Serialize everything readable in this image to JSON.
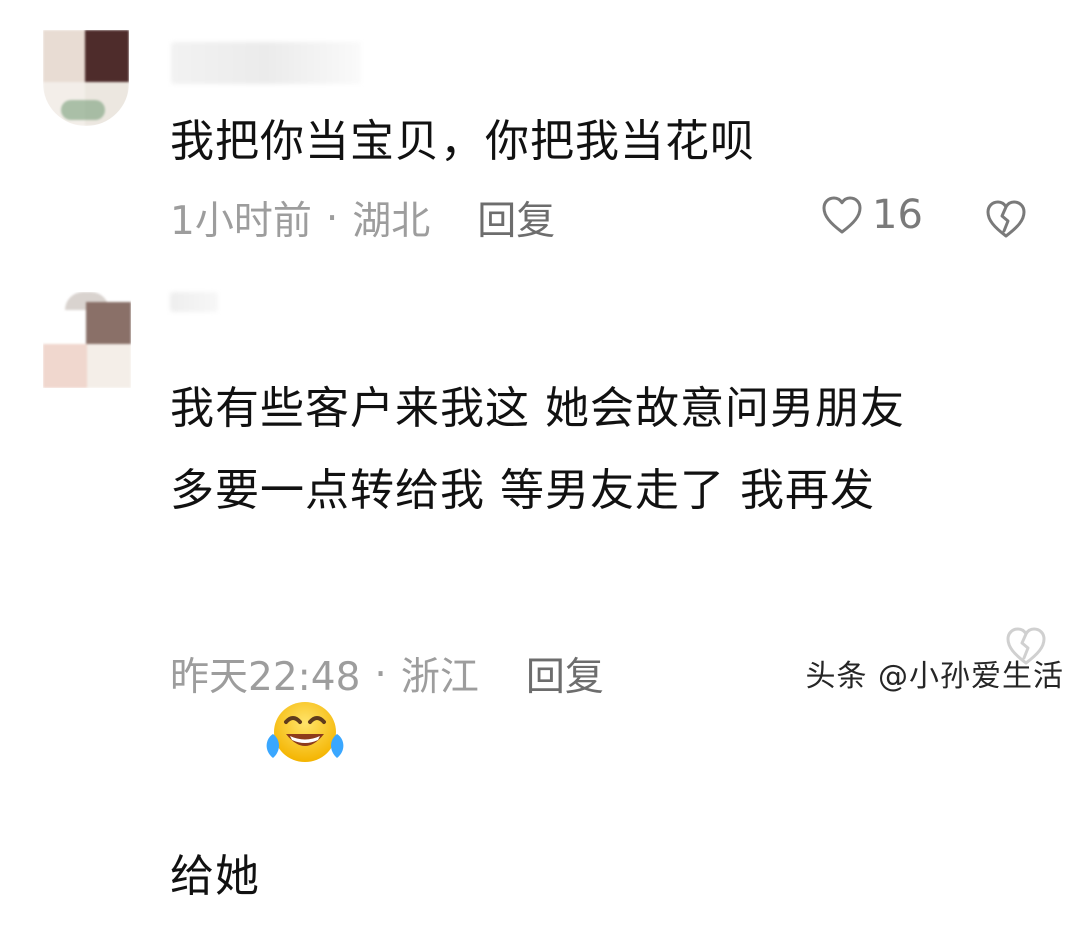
{
  "comments": [
    {
      "text": "我把你当宝贝，你把我当花呗",
      "time": "1小时前",
      "location": "湖北",
      "reply": "回复",
      "likes": "16"
    },
    {
      "text": "我有些客户来我这 她会故意问男朋友\n多要一点转给我 等男友走了 我再发\n给她",
      "time": "昨天22:48",
      "location": "浙江",
      "reply": "回复"
    }
  ],
  "ui": {
    "dot": "·",
    "watermark": "头条 @小孙爱生活",
    "icons": {
      "like": "heart-outline-icon",
      "dislike": "broken-heart-icon",
      "emoji": "tears-of-joy-emoji-icon"
    }
  }
}
